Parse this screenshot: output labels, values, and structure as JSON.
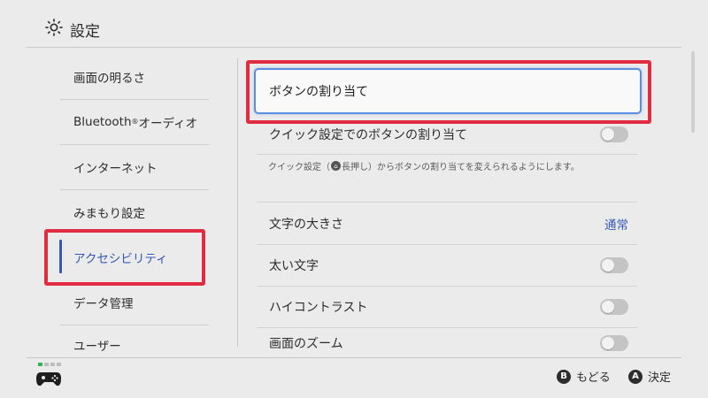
{
  "header": {
    "title": "設定",
    "icon": "gear-icon"
  },
  "sidebar": {
    "items": [
      {
        "label": "画面の明るさ"
      },
      {
        "label": "Bluetooth",
        "sup": "®",
        "suffix": "オーディオ"
      },
      {
        "label": "インターネット"
      },
      {
        "label": "みまもり設定"
      },
      {
        "label": "アクセシビリティ",
        "active": true
      },
      {
        "label": "データ管理"
      },
      {
        "label": "ユーザー"
      }
    ]
  },
  "main": {
    "button_mapping": "ボタンの割り当て",
    "quick_mapping": {
      "label": "クイック設定でのボタンの割り当て",
      "toggle": "off"
    },
    "note": {
      "before": "クイック設定（",
      "icon": "home-icon",
      "after": " 長押し）からボタンの割り当てを変えられるようにします。"
    },
    "text_size": {
      "label": "文字の大きさ",
      "value": "通常"
    },
    "bold_text": {
      "label": "太い文字",
      "toggle": "off"
    },
    "high_contrast": {
      "label": "ハイコントラスト",
      "toggle": "off"
    },
    "zoom": {
      "label": "画面のズーム",
      "toggle": "off"
    }
  },
  "footer": {
    "back": {
      "glyph": "B",
      "label": "もどる"
    },
    "ok": {
      "glyph": "A",
      "label": "決定"
    }
  },
  "colors": {
    "accent": "#3558b5",
    "highlight_red": "#e02b41",
    "focus_blue": "#5a8ee0",
    "background": "#ebebeb"
  }
}
